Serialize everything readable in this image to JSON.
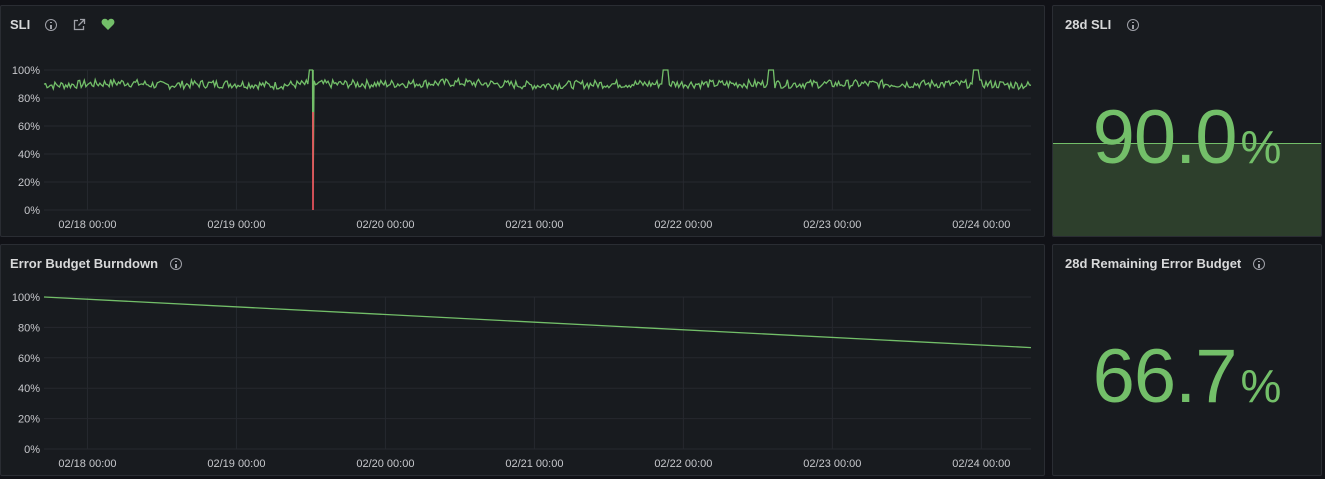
{
  "colors": {
    "series": "#73bf69",
    "alert": "#f2495c",
    "grid": "#26292f",
    "axis_text": "#c7c8cc",
    "stat_fill": "#2d3f2c"
  },
  "panels": {
    "sli": {
      "title": "SLI",
      "icons": [
        "info-icon",
        "external-link-icon",
        "heart-icon"
      ]
    },
    "sli_28d": {
      "title": "28d SLI",
      "value": "90.0",
      "unit": "%",
      "icons": [
        "info-icon"
      ]
    },
    "burndown": {
      "title": "Error Budget Burndown",
      "icons": [
        "info-icon"
      ]
    },
    "remaining": {
      "title": "28d Remaining Error Budget",
      "value": "66.7",
      "unit": "%",
      "icons": [
        "info-icon"
      ]
    }
  },
  "chart_data": [
    {
      "type": "line",
      "title": "SLI",
      "x_ticks": [
        "02/18 00:00",
        "02/19 00:00",
        "02/20 00:00",
        "02/21 00:00",
        "02/22 00:00",
        "02/23 00:00",
        "02/24 00:00"
      ],
      "y_ticks": [
        "0%",
        "20%",
        "40%",
        "60%",
        "80%",
        "100%"
      ],
      "ylim": [
        0,
        100
      ],
      "xlim": [
        "02/17 17:00",
        "02/24 08:00"
      ],
      "series": [
        {
          "baseline": 90,
          "points": [
            [
              "02/17 17:00",
              90
            ],
            [
              "02/17 18:30",
              89
            ],
            [
              "02/18 00:00",
              90
            ],
            [
              "02/18 06:00",
              91
            ],
            [
              "02/18 12:00",
              89
            ],
            [
              "02/18 18:00",
              90
            ],
            [
              "02/19 00:00",
              90
            ],
            [
              "02/19 06:00",
              89
            ],
            [
              "02/19 11:30",
              90
            ],
            [
              "02/19 11:45",
              100
            ],
            [
              "02/19 12:15",
              100
            ],
            [
              "02/19 12:20",
              0
            ],
            [
              "02/19 12:30",
              90
            ],
            [
              "02/20 00:00",
              90
            ],
            [
              "02/20 12:00",
              91
            ],
            [
              "02/21 00:00",
              89
            ],
            [
              "02/21 12:00",
              90
            ],
            [
              "02/21 20:30",
              90
            ],
            [
              "02/21 20:45",
              100
            ],
            [
              "02/21 21:30",
              100
            ],
            [
              "02/21 21:45",
              90
            ],
            [
              "02/22 12:00",
              90
            ],
            [
              "02/22 13:30",
              90
            ],
            [
              "02/22 13:45",
              100
            ],
            [
              "02/22 14:30",
              100
            ],
            [
              "02/22 14:45",
              90
            ],
            [
              "02/23 12:00",
              90
            ],
            [
              "02/23 22:30",
              90
            ],
            [
              "02/23 22:45",
              100
            ],
            [
              "02/23 23:30",
              100
            ],
            [
              "02/23 23:45",
              90
            ],
            [
              "02/24 08:00",
              89
            ]
          ]
        }
      ],
      "dip": {
        "x": "02/19 12:20",
        "min": 0,
        "color": "#f2495c"
      }
    },
    {
      "type": "line",
      "title": "Error Budget Burndown",
      "x_ticks": [
        "02/18 00:00",
        "02/19 00:00",
        "02/20 00:00",
        "02/21 00:00",
        "02/22 00:00",
        "02/23 00:00",
        "02/24 00:00"
      ],
      "y_ticks": [
        "0%",
        "20%",
        "40%",
        "60%",
        "80%",
        "100%"
      ],
      "ylim": [
        0,
        100
      ],
      "xlim": [
        "02/17 17:00",
        "02/24 08:00"
      ],
      "series": [
        {
          "points": [
            [
              "02/17 17:00",
              100
            ],
            [
              "02/24 08:00",
              66.7
            ]
          ]
        }
      ]
    }
  ]
}
